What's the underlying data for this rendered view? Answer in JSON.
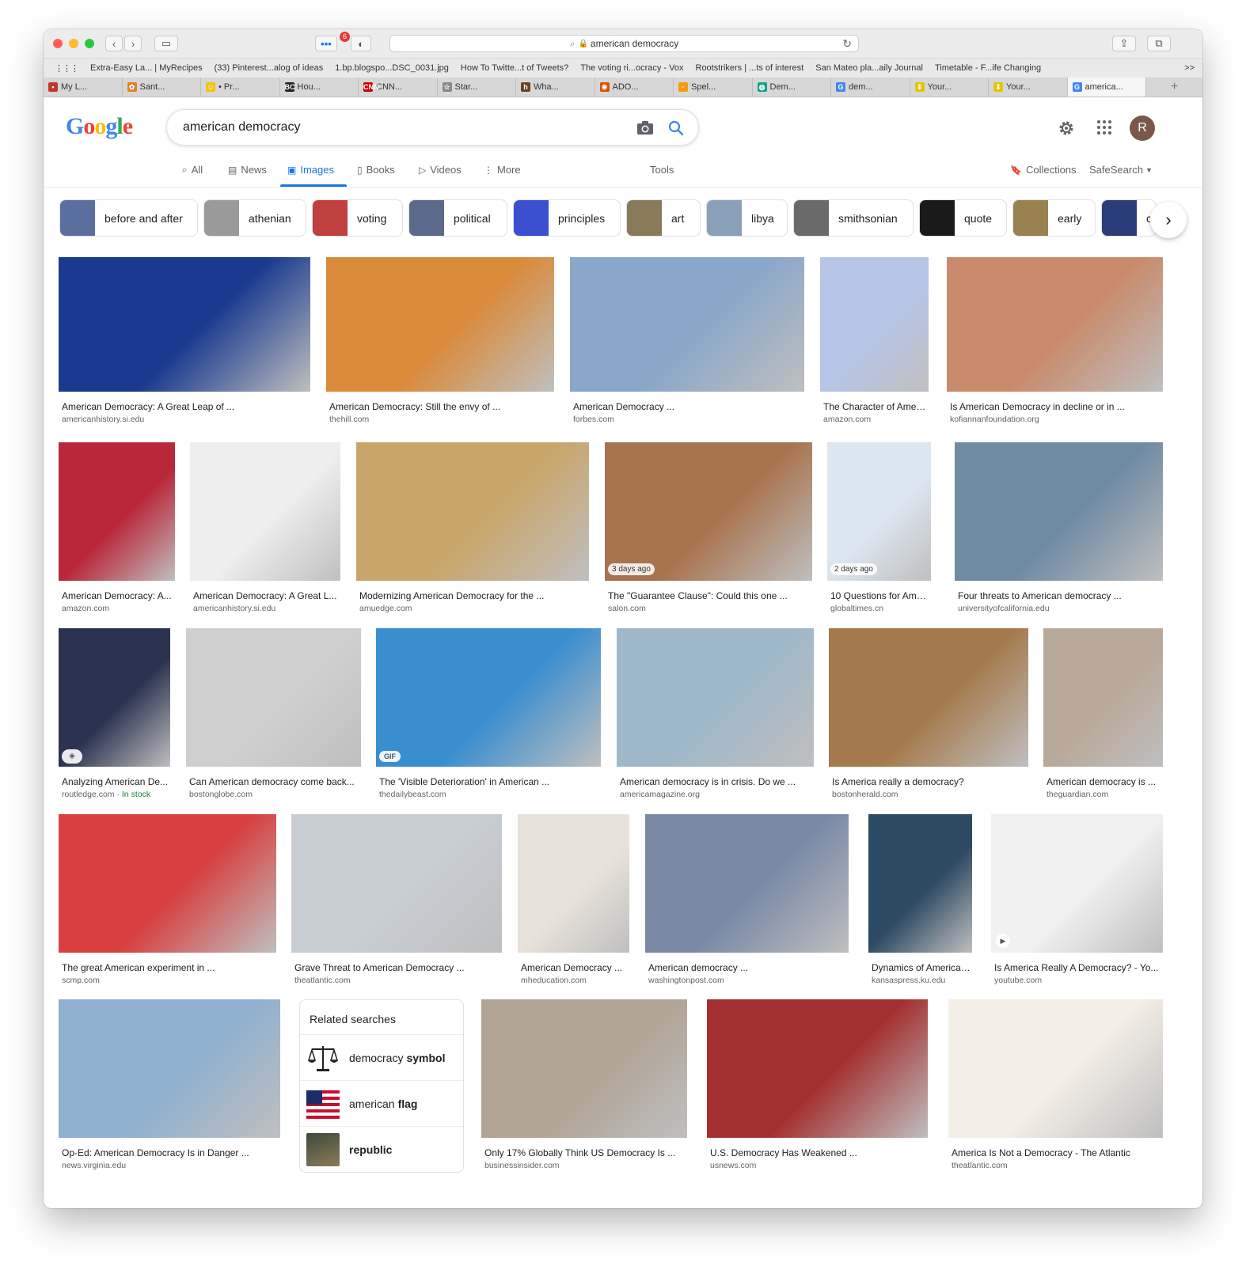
{
  "browser": {
    "url": "american democracy",
    "tab_badge": "6",
    "bookmarks": [
      "Extra-Easy La... | MyRecipes",
      "(33) Pinterest...alog of ideas",
      "1.bp.blogspo...DSC_0031.jpg",
      "How To Twitte...t of Tweets?",
      "The voting ri...ocracy - Vox",
      "Rootstrikers | ...ts of interest",
      "San Mateo pla...aily Journal",
      "Timetable - F...ife Changing"
    ],
    "bookmarks_more": ">>",
    "tabs": [
      {
        "label": "My L...",
        "fav": "▪",
        "color": "#c0392b"
      },
      {
        "label": "Sant...",
        "fav": "✿",
        "color": "#e67e22"
      },
      {
        "label": "• Pr...",
        "fav": "☺",
        "color": "#f1c40f"
      },
      {
        "label": "Hou...",
        "fav": "BC",
        "color": "#222222"
      },
      {
        "label": "CNN...",
        "fav": "CNN",
        "color": "#cc0000"
      },
      {
        "label": "Star...",
        "fav": "☆",
        "color": "#888888"
      },
      {
        "label": "Wha...",
        "fav": "h",
        "color": "#6b4226"
      },
      {
        "label": "ADO...",
        "fav": "❀",
        "color": "#d35400"
      },
      {
        "label": "Spel...",
        "fav": "·",
        "color": "#f39c12"
      },
      {
        "label": "Dem...",
        "fav": "◍",
        "color": "#16a085"
      },
      {
        "label": "dem...",
        "fav": "G",
        "color": "#4285f4"
      },
      {
        "label": "Your...",
        "fav": "⬇",
        "color": "#e8c400"
      },
      {
        "label": "Your...",
        "fav": "⬇",
        "color": "#e8c400"
      },
      {
        "label": "america...",
        "fav": "G",
        "color": "#4285f4"
      }
    ]
  },
  "google": {
    "logo": "Google",
    "query": "american democracy",
    "avatar_letter": "R",
    "nav": [
      "All",
      "News",
      "Images",
      "Books",
      "Videos",
      "More"
    ],
    "tools": "Tools",
    "collections": "Collections",
    "safesearch": "SafeSearch"
  },
  "chips": [
    "before and after",
    "athenian",
    "voting",
    "political",
    "principles",
    "art",
    "libya",
    "smithsonian",
    "quote",
    "early",
    "c"
  ],
  "results": [
    {
      "caption": "American Democracy: A Great Leap of ...",
      "source": "americanhistory.si.edu",
      "color": "#1a3a8f"
    },
    {
      "caption": "American Democracy: Still the envy of ...",
      "source": "thehill.com",
      "color": "#d98a3a"
    },
    {
      "caption": "American Democracy ...",
      "source": "forbes.com",
      "color": "#8aa7c9"
    },
    {
      "caption": "The Character of Ameri...",
      "source": "amazon.com",
      "color": "#b7c6e6"
    },
    {
      "caption": "Is American Democracy in decline or in ...",
      "source": "kofiannanfoundation.org",
      "color": "#c98a6b"
    },
    {
      "caption": "American Democracy: A...",
      "source": "amazon.com",
      "color": "#b8283a"
    },
    {
      "caption": "American Democracy: A Great L...",
      "source": "americanhistory.si.edu",
      "color": "#eeeeee"
    },
    {
      "caption": "Modernizing American Democracy for the ...",
      "source": "amuedge.com",
      "color": "#c9a56b"
    },
    {
      "caption": "The \"Guarantee Clause\": Could this one ...",
      "source": "salon.com",
      "color": "#a8744f"
    },
    {
      "caption": "10 Questions for Ameri...",
      "source": "globaltimes.cn",
      "color": "#dce6ef"
    },
    {
      "caption": "Four threats to American democracy ...",
      "source": "universityofcalifornia.edu",
      "color": "#6f8aa3"
    },
    {
      "caption": "Analyzing American De...",
      "source": "routledge.com",
      "source_extra": "In stock",
      "color": "#2b3350"
    },
    {
      "caption": "Can American democracy come back...",
      "source": "bostonglobe.com",
      "color": "#cfcfcf"
    },
    {
      "caption": "The 'Visible Deterioration' in American ...",
      "source": "thedailybeast.com",
      "color": "#3a8ed0"
    },
    {
      "caption": "American democracy is in crisis. Do we ...",
      "source": "americamagazine.org",
      "color": "#9fb8c9"
    },
    {
      "caption": "Is America really a democracy?",
      "source": "bostonherald.com",
      "color": "#a57a4c"
    },
    {
      "caption": "American democracy is ...",
      "source": "theguardian.com",
      "color": "#b9a99a"
    },
    {
      "caption": "The great American experiment in ...",
      "source": "scmp.com",
      "color": "#d84040"
    },
    {
      "caption": "Grave Threat to American Democracy ...",
      "source": "theatlantic.com",
      "color": "#c8cdd3"
    },
    {
      "caption": "American Democracy ...",
      "source": "mheducation.com",
      "color": "#e8e3da"
    },
    {
      "caption": "American democracy ...",
      "source": "washingtonpost.com",
      "color": "#7a8aa6"
    },
    {
      "caption": "Dynamics of American ...",
      "source": "kansaspress.ku.edu",
      "color": "#2d4a63"
    },
    {
      "caption": "Is America Really A Democracy? - Yo...",
      "source": "youtube.com",
      "color": "#f1f1f1"
    },
    {
      "caption": "Op-Ed: American Democracy Is in Danger ...",
      "source": "news.virginia.edu",
      "color": "#8fb0cf"
    },
    {
      "caption": "Only 17% Globally Think US Democracy Is ...",
      "source": "businessinsider.com",
      "color": "#b0a394"
    },
    {
      "caption": "U.S. Democracy Has Weakened ...",
      "source": "usnews.com",
      "color": "#a33030"
    },
    {
      "caption": "America Is Not a Democracy - The Atlantic",
      "source": "theatlantic.com",
      "color": "#f3eee6"
    }
  ],
  "overlays": {
    "days_ago_1": "3 days ago",
    "days_ago_2": "2 days ago",
    "gif": "GIF"
  },
  "related": {
    "title": "Related searches",
    "items": [
      {
        "pre": "democracy ",
        "bold": "symbol"
      },
      {
        "pre": "american ",
        "bold": "flag"
      },
      {
        "pre": "",
        "bold": "republic"
      }
    ]
  },
  "colors": {
    "accent": "#1a73e8",
    "text": "#202124",
    "muted": "#5f6368"
  }
}
